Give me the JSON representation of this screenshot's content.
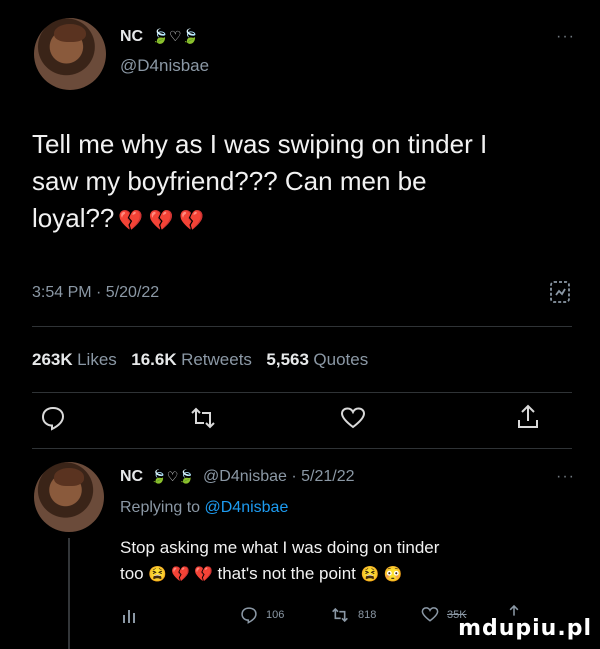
{
  "tweet": {
    "display_name": "NC",
    "name_emojis": "🍃♡🍃",
    "handle": "@D4nisbae",
    "more": "···",
    "text_line1": "Tell me why as I was swiping on tinder I",
    "text_line2": "saw my boyfriend??? Can men be",
    "text_line3": "loyal??",
    "text_emojis": "💔 💔 💔",
    "timestamp": "3:54 PM · 5/20/22",
    "stats": {
      "likes_count": "263K",
      "likes_label": "Likes",
      "retweets_count": "16.6K",
      "retweets_label": "Retweets",
      "quotes_count": "5,563",
      "quotes_label": "Quotes"
    }
  },
  "reply": {
    "display_name": "NC",
    "name_emojis": "🍃♡🍃",
    "handle_date": "@D4nisbae · 5/21/22",
    "more": "···",
    "replying_prefix": "Replying to",
    "replying_handle": "@D4nisbae",
    "text_line1": "Stop asking me what I was doing on tinder",
    "text_line2_a": "too",
    "text_line2_emojis": "😫 💔 💔",
    "text_line2_b": "that's not the point",
    "text_line2_end": "😫 😳",
    "reply_count": "106",
    "retweet_count": "818",
    "like_count": "35K"
  },
  "watermark": "mdupiu.pl"
}
